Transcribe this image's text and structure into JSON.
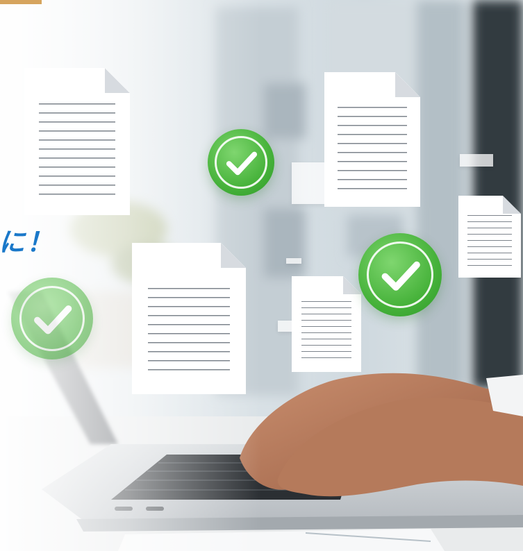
{
  "headline": {
    "text": "に！",
    "color": "#1a78c9"
  },
  "icons": {
    "document": "document-icon",
    "check": "check-circle-icon"
  },
  "colors": {
    "check_green": "#46b23a",
    "accent_blue": "#1a78c9"
  }
}
